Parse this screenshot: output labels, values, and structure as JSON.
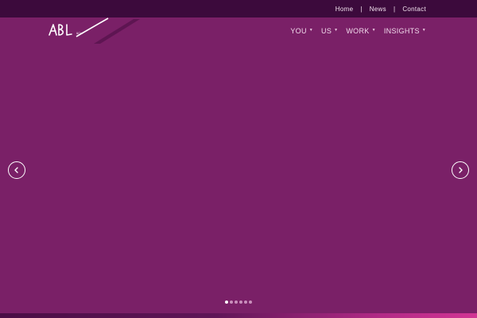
{
  "colors": {
    "background": "#7a2067",
    "topbar": "#3c0a3c",
    "accent": "#d23594",
    "text": "#ffffff"
  },
  "topnav": {
    "links": [
      {
        "label": "Home"
      },
      {
        "label": "News"
      },
      {
        "label": "Contact"
      }
    ],
    "separator": "|"
  },
  "mainnav": {
    "items": [
      {
        "label": "YOU",
        "has_dropdown": true
      },
      {
        "label": "US",
        "has_dropdown": true
      },
      {
        "label": "WORK",
        "has_dropdown": true
      },
      {
        "label": "INSIGHTS",
        "has_dropdown": true
      }
    ]
  },
  "logo": {
    "text": "ABL",
    "subtext": "&Co."
  },
  "slider": {
    "prev_icon": "chevron-left-icon",
    "next_icon": "chevron-right-icon",
    "slide_count": 6,
    "active_index": 0
  }
}
